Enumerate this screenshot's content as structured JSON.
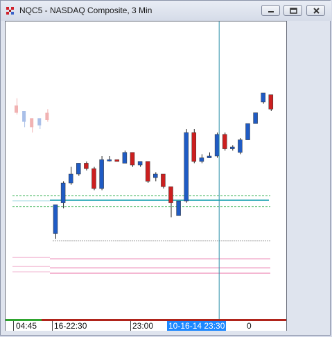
{
  "window": {
    "title": "NQC5 - NASDAQ Composite, 3 Min",
    "controls": [
      "minimize",
      "restore",
      "close"
    ]
  },
  "time_axis": {
    "ticks": [
      "04:45",
      "16-22:30",
      "23:00"
    ],
    "cursor_label": "10-16-14  23:30",
    "cursor_tail": "0"
  },
  "colors": {
    "up": "#1f5bc4",
    "down": "#cc1f1f",
    "cursor_line": "#2b8fa8",
    "level_main": "#1fa3b3",
    "level_green": "#2fae4a",
    "level_pink": "#e86fa6",
    "level_gray": "#8c8c8c"
  },
  "chart_data": {
    "type": "candlestick",
    "cursor_index": 22,
    "ylim": [
      0,
      100
    ],
    "faded_candles": [
      {
        "o": 88,
        "h": 92,
        "l": 83,
        "c": 84
      },
      {
        "o": 79,
        "h": 85,
        "l": 76,
        "c": 85
      },
      {
        "o": 81,
        "h": 80,
        "l": 73,
        "c": 76
      },
      {
        "o": 77,
        "h": 81,
        "l": 75,
        "c": 81
      },
      {
        "o": 84,
        "h": 86,
        "l": 79,
        "c": 80
      }
    ],
    "candles": [
      {
        "o": 17,
        "h": 33,
        "l": 14,
        "c": 33
      },
      {
        "o": 34,
        "h": 46,
        "l": 31,
        "c": 45
      },
      {
        "o": 45,
        "h": 54,
        "l": 44,
        "c": 50
      },
      {
        "o": 50,
        "h": 56,
        "l": 49,
        "c": 56
      },
      {
        "o": 56,
        "h": 57,
        "l": 52,
        "c": 53
      },
      {
        "o": 53,
        "h": 54,
        "l": 41,
        "c": 42
      },
      {
        "o": 42,
        "h": 60,
        "l": 41,
        "c": 58
      },
      {
        "o": 58,
        "h": 60,
        "l": 57,
        "c": 58
      },
      {
        "o": 58,
        "h": 58,
        "l": 57,
        "c": 57
      },
      {
        "o": 56,
        "h": 63,
        "l": 56,
        "c": 62
      },
      {
        "o": 62,
        "h": 62,
        "l": 54,
        "c": 55
      },
      {
        "o": 55,
        "h": 57,
        "l": 54,
        "c": 57
      },
      {
        "o": 57,
        "h": 57,
        "l": 45,
        "c": 46
      },
      {
        "o": 48,
        "h": 51,
        "l": 46,
        "c": 50
      },
      {
        "o": 50,
        "h": 50,
        "l": 42,
        "c": 43
      },
      {
        "o": 43,
        "h": 39,
        "l": 26,
        "c": 34
      },
      {
        "o": 27,
        "h": 35,
        "l": 27,
        "c": 35
      },
      {
        "o": 35,
        "h": 75,
        "l": 34,
        "c": 73
      },
      {
        "o": 73,
        "h": 75,
        "l": 56,
        "c": 57
      },
      {
        "o": 57,
        "h": 61,
        "l": 56,
        "c": 59
      },
      {
        "o": 59,
        "h": 62,
        "l": 59,
        "c": 60
      },
      {
        "o": 60,
        "h": 73,
        "l": 59,
        "c": 72
      },
      {
        "o": 72,
        "h": 73,
        "l": 63,
        "c": 64
      },
      {
        "o": 64,
        "h": 66,
        "l": 63,
        "c": 65
      },
      {
        "o": 62,
        "h": 70,
        "l": 61,
        "c": 69
      },
      {
        "o": 69,
        "h": 78,
        "l": 69,
        "c": 78
      },
      {
        "o": 78,
        "h": 83,
        "l": 78,
        "c": 84
      },
      {
        "o": 90,
        "h": 95,
        "l": 89,
        "c": 95
      },
      {
        "o": 94,
        "h": 94,
        "l": 85,
        "c": 86
      }
    ],
    "levels": {
      "main": 35.5,
      "green_upper": 38,
      "green_lower": 32,
      "gray": 13,
      "pink": [
        3,
        -2,
        -5
      ]
    }
  }
}
